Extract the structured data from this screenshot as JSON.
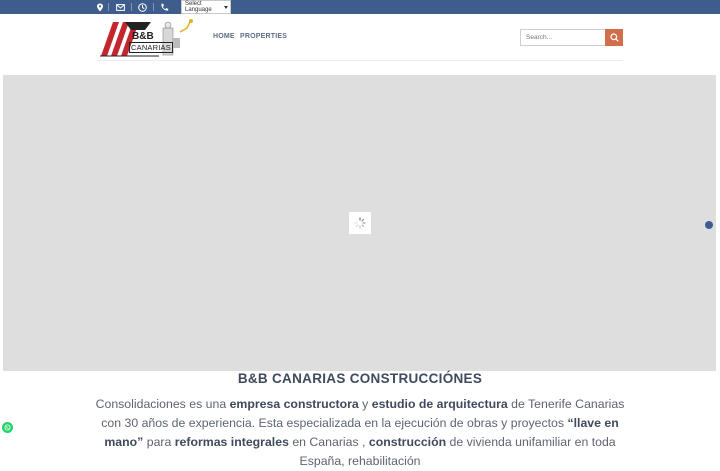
{
  "topbar": {
    "language_select": "Select Language",
    "icons": [
      "location-icon",
      "envelope-icon",
      "clock-icon",
      "phone-icon"
    ],
    "color": "#3f5d8c"
  },
  "header": {
    "logo_text": "B&B",
    "logo_subtext": "CANARIAS",
    "nav": [
      "HOME",
      "PROPERTIES"
    ],
    "search_placeholder": "Search...",
    "accent_color": "#d26e4b"
  },
  "hero": {
    "loading": true,
    "dot_color": "#3f5d8c"
  },
  "content": {
    "heading": "B&B CANARIAS CONSTRUCCIÓNES",
    "para1_a": "Consolidaciones es una ",
    "para1_b": "empresa constructora",
    "para1_c": " y ",
    "para1_d": "estudio de arquitectura",
    "para1_e": " de Tenerife Canarias con 30 años de experiencia. Esta especializada en la ejecución de obras y proyectos ",
    "para1_f": "“llave en mano”",
    "para1_g": " para ",
    "para1_h": "reformas integrales",
    "para1_i": " en Canarias , ",
    "para1_j": "construcción",
    "para1_k": " de vivienda unifamiliar en toda España, rehabilitación"
  }
}
